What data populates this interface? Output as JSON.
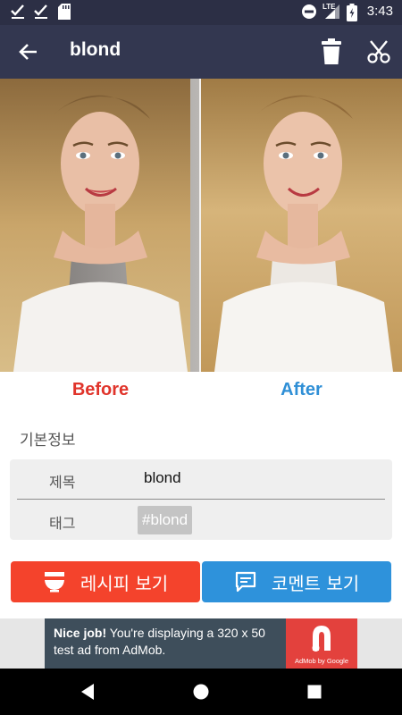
{
  "status_bar": {
    "time": "3:43",
    "network_label": "LTE",
    "left_icons": [
      "check-icon",
      "check-icon",
      "sd-card-icon"
    ],
    "right_icons": [
      "do-not-disturb-icon",
      "signal-icon",
      "battery-icon"
    ]
  },
  "app_bar": {
    "title": "blond",
    "back_icon": "arrow-left-icon",
    "actions": [
      "trash-icon",
      "scissors-icon"
    ],
    "background": "#333750"
  },
  "photos": {
    "before_label": "Before",
    "after_label": "After",
    "before_color": "#e0342b",
    "after_color": "#2f8fd6"
  },
  "info": {
    "section_title": "기본정보",
    "title_key": "제목",
    "title_value": "blond",
    "tag_key": "태그",
    "tag_value": "#blond"
  },
  "actions": {
    "recipe_label": "레시피 보기",
    "recipe_icon": "bowl-icon",
    "recipe_color": "#f4432c",
    "comment_label": "코멘트 보기",
    "comment_icon": "comment-icon",
    "comment_color": "#2e92db"
  },
  "ad": {
    "headline": "Nice job!",
    "body": " You're displaying a 320 x 50 test ad from AdMob.",
    "logo_caption": "AdMob by Google"
  },
  "nav": {
    "icons": [
      "back-triangle-icon",
      "home-circle-icon",
      "recents-square-icon"
    ]
  }
}
